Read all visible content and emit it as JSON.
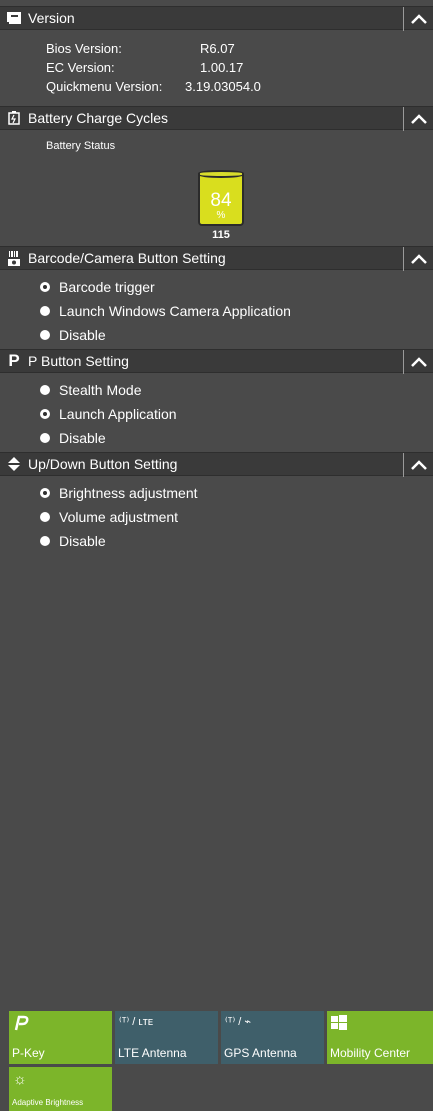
{
  "version": {
    "title": "Version",
    "rows": [
      {
        "label": "Bios Version:",
        "value": "R6.07"
      },
      {
        "label": "EC Version:",
        "value": "1.00.17"
      },
      {
        "label": "Quickmenu Version:",
        "value": "3.19.03054.0"
      }
    ]
  },
  "battery": {
    "title": "Battery Charge Cycles",
    "status_label": "Battery Status",
    "percent": "84",
    "percent_sign": "%",
    "cycles": "115",
    "fill_color": "#d9de1e"
  },
  "barcode": {
    "title": "Barcode/Camera Button Setting",
    "options": [
      "Barcode trigger",
      "Launch Windows Camera Application",
      "Disable"
    ],
    "selected_index": 0
  },
  "pbutton": {
    "title": "P Button Setting",
    "options": [
      "Stealth Mode",
      "Launch Application",
      "Disable"
    ],
    "selected_index": 1
  },
  "updown": {
    "title": "Up/Down Button Setting",
    "options": [
      "Brightness adjustment",
      "Volume adjustment",
      "Disable"
    ],
    "selected_index": 0
  },
  "tiles": [
    {
      "label": "P-Key",
      "icon": "p-key-icon",
      "color": "#7cb52a"
    },
    {
      "label": "LTE Antenna",
      "icon": "lte-antenna-icon",
      "color": "#3f5f6a"
    },
    {
      "label": "GPS Antenna",
      "icon": "gps-antenna-icon",
      "color": "#3f5f6a"
    },
    {
      "label": "Mobility Center",
      "icon": "windows-icon",
      "color": "#7cb52a"
    },
    {
      "label": "Adaptive Brightness",
      "icon": "brightness-icon",
      "color": "#7cb52a"
    }
  ],
  "colors": {
    "background": "#4a4a4a",
    "header": "#3a3a3a",
    "accent_green": "#7cb52a",
    "tile_blue": "#3f5f6a"
  }
}
